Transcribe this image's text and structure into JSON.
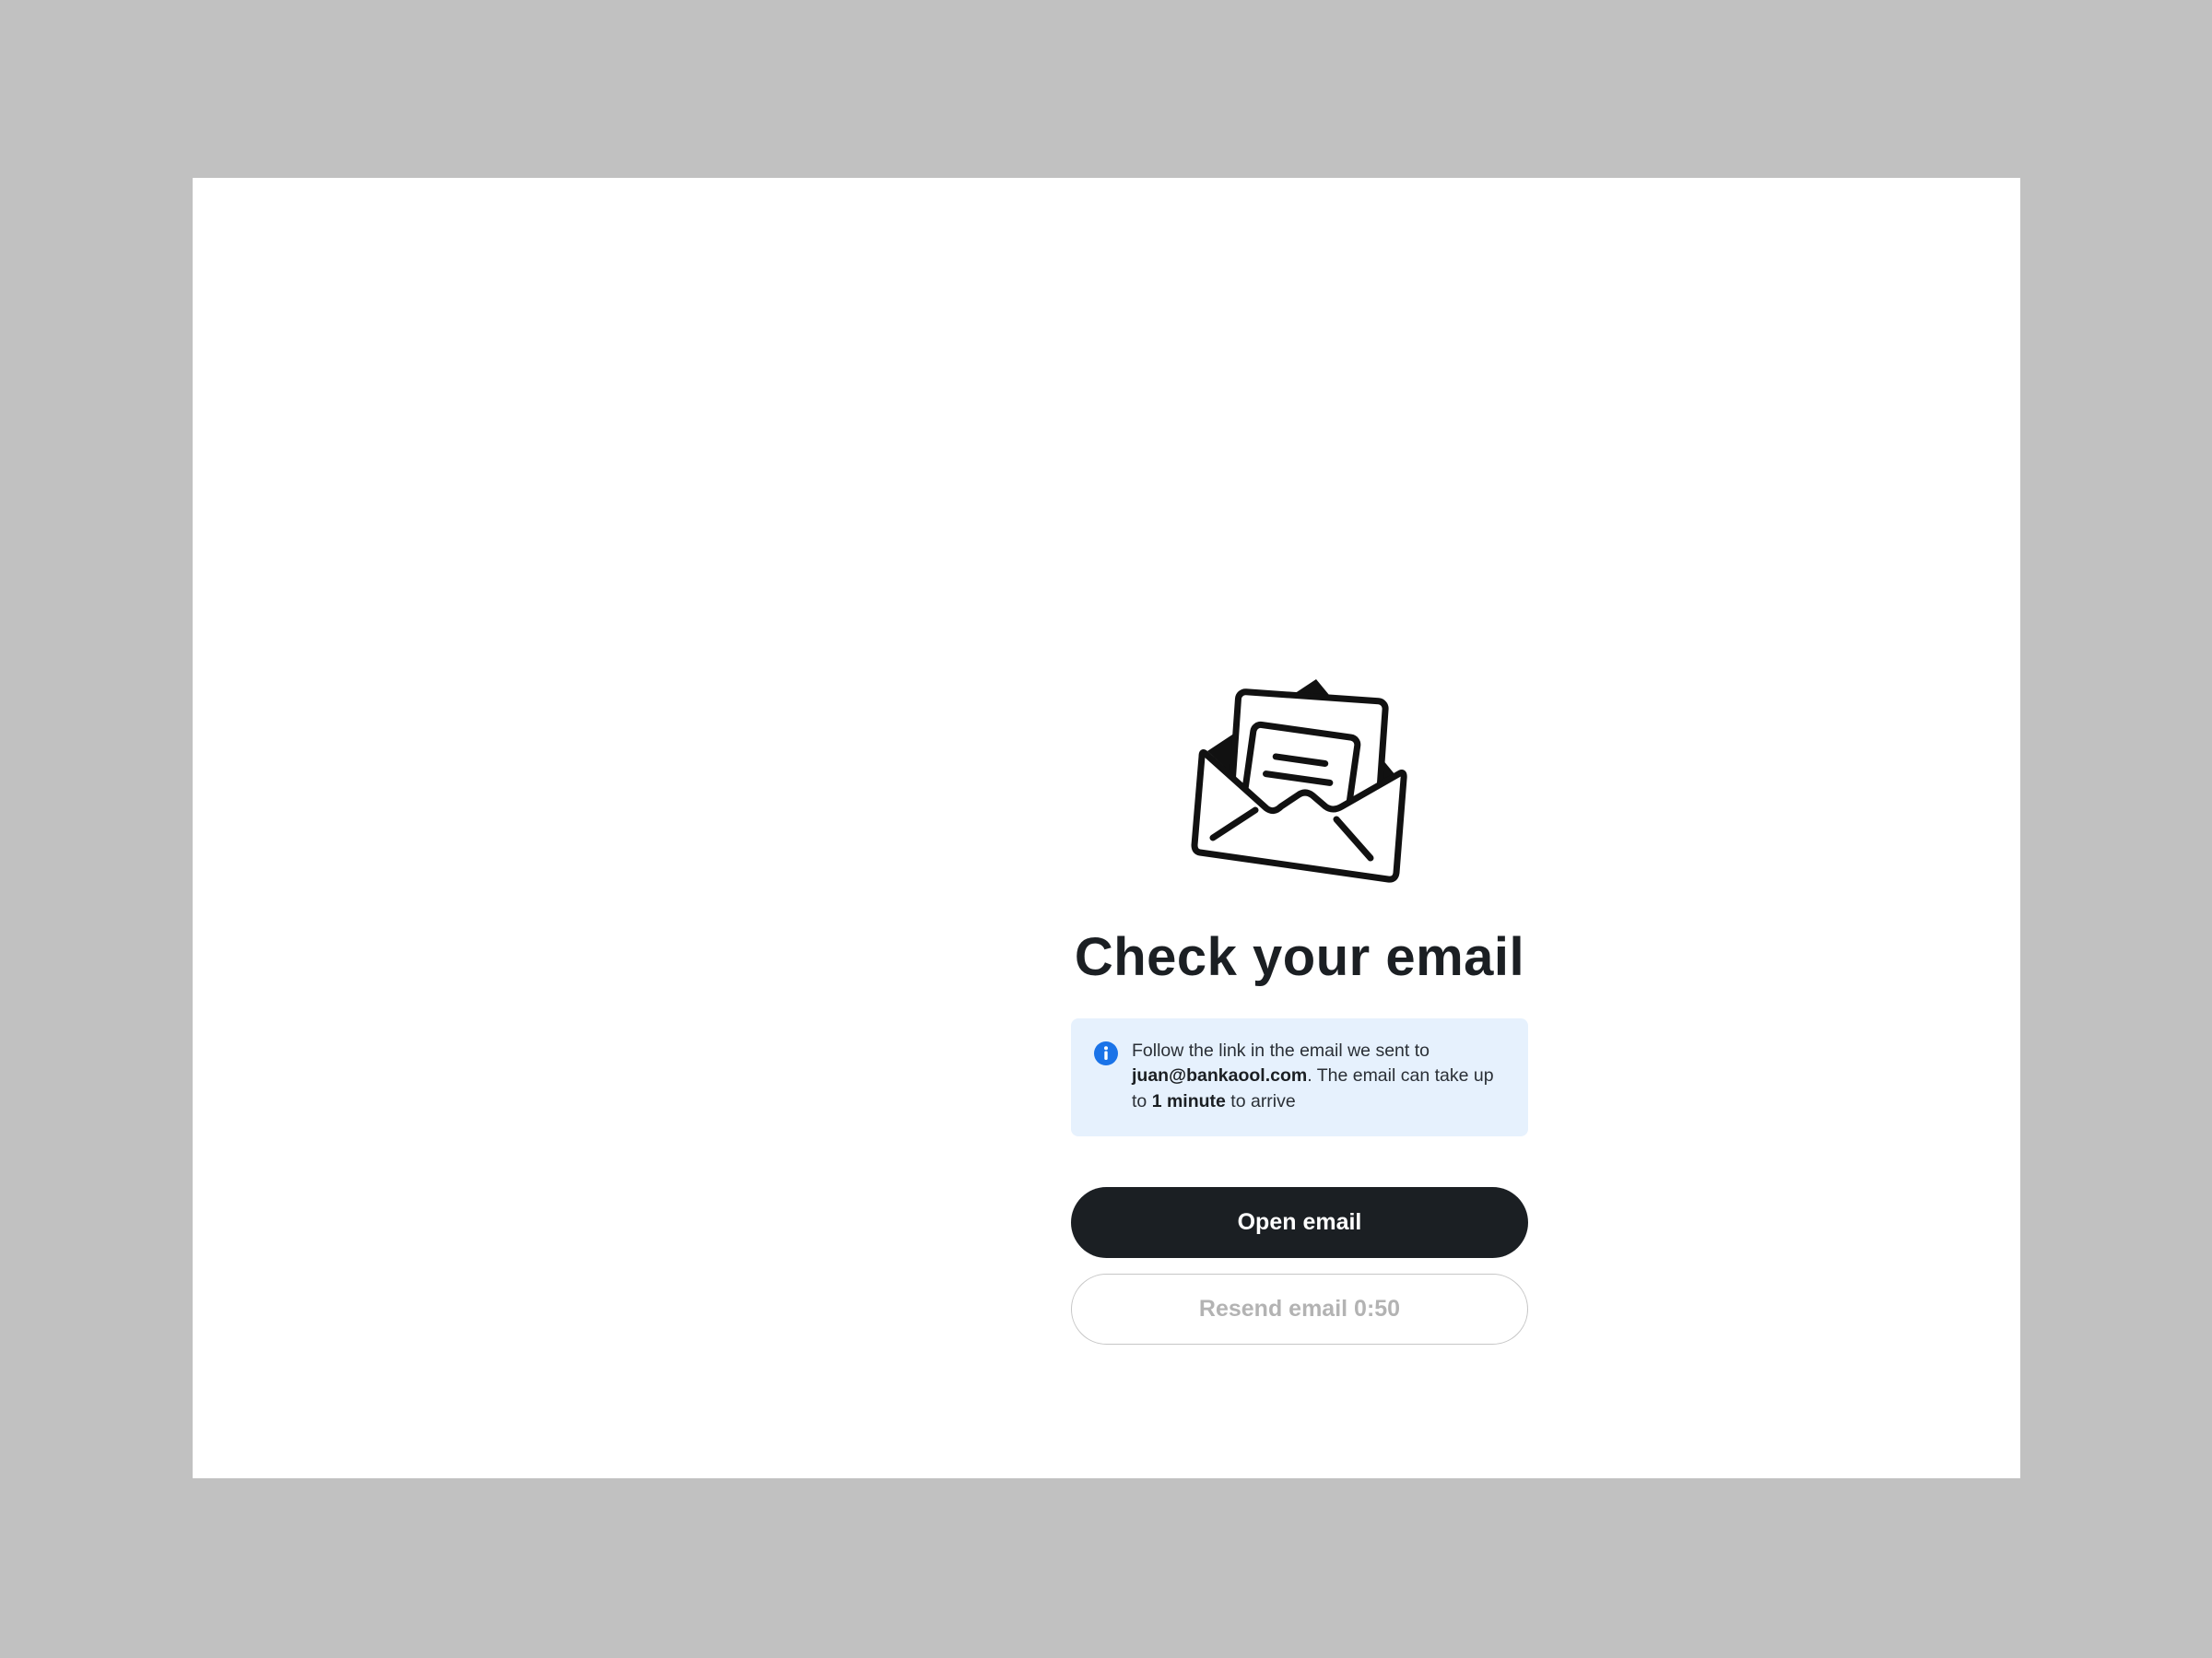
{
  "page": {
    "title": "Check your email"
  },
  "info": {
    "text_before_email": "Follow the link in the email we sent to ",
    "email": "juan@bankaool.com",
    "text_after_email": ". The email can take up to ",
    "duration": "1 minute",
    "text_end": " to arrive",
    "icon": "info-icon",
    "icon_color": "#1a73e8",
    "background": "#e6f1fd"
  },
  "actions": {
    "open_email_label": "Open email",
    "resend_label": "Resend email 0:50"
  },
  "colors": {
    "primary_button": "#1b1f23",
    "disabled_text": "#b3b3b3"
  }
}
